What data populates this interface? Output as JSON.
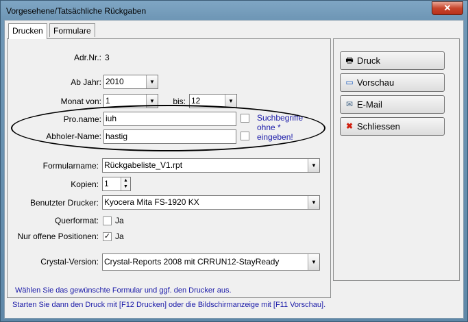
{
  "window": {
    "title": "Vorgesehene/Tatsächliche Rückgaben",
    "close_icon": "x"
  },
  "tabs": [
    {
      "label": "Drucken"
    },
    {
      "label": "Formulare"
    }
  ],
  "form": {
    "adr_label": "Adr.Nr.:",
    "adr_value": "3",
    "ab_jahr_label": "Ab Jahr:",
    "ab_jahr_value": "2010",
    "monat_von_label": "Monat von:",
    "monat_von_value": "1",
    "bis_label": "bis:",
    "bis_value": "12",
    "proname_label": "Pro.name:",
    "proname_value": "iuh",
    "abholer_label": "Abholer-Name:",
    "abholer_value": "hastig",
    "suchbegriffe_hint": [
      "Suchbegriffe",
      "ohne *",
      "eingeben!"
    ],
    "formularname_label": "Formularname:",
    "formularname_value": "Rückgabeliste_V1.rpt",
    "kopien_label": "Kopien:",
    "kopien_value": "1",
    "drucker_label": "Benutzter Drucker:",
    "drucker_value": "Kyocera Mita FS-1920 KX",
    "querformat_label": "Querformat:",
    "querformat_checked": false,
    "querformat_text": "Ja",
    "offene_label": "Nur offene Positionen:",
    "offene_checked": true,
    "offene_text": "Ja",
    "crystal_label": "Crystal-Version:",
    "crystal_value": "Crystal-Reports 2008 mit CRRUN12-StayReady"
  },
  "buttons": [
    {
      "label": "Druck",
      "icon": "printer-icon"
    },
    {
      "label": "Vorschau",
      "icon": "monitor-icon"
    },
    {
      "label": "E-Mail",
      "icon": "envelope-icon"
    },
    {
      "label": "Schliessen",
      "icon": "close-x-icon"
    }
  ],
  "hints": [
    "Wählen Sie das gewünschte Formular und ggf. den Drucker aus.",
    "Starten Sie dann den Druck mit [F12 Drucken] oder die Bildschirmanzeige mit [F11 Vorschau]."
  ],
  "colors": {
    "hint_text": "#1a1aa8",
    "suchbegriffe_text": "#1a1aa8",
    "close_button": "#c7452c"
  }
}
